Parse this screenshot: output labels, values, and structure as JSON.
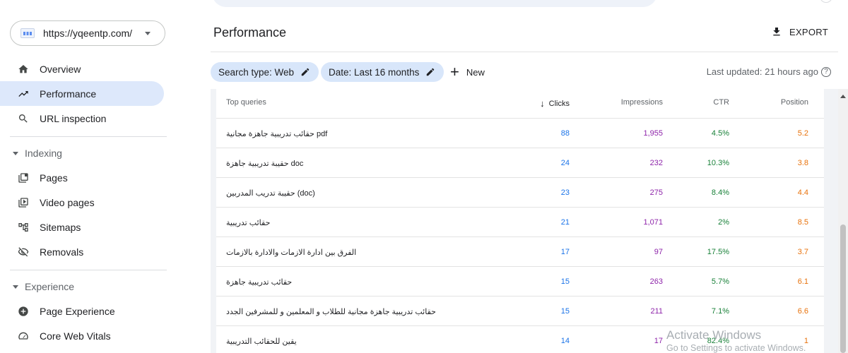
{
  "sidebar": {
    "property_url": "https://yqeentp.com/",
    "nav": [
      {
        "label": "Overview",
        "icon": "home-icon"
      },
      {
        "label": "Performance",
        "icon": "trending-up-icon",
        "active": true
      },
      {
        "label": "URL inspection",
        "icon": "search-icon"
      }
    ],
    "indexing": {
      "heading": "Indexing",
      "items": [
        {
          "label": "Pages",
          "icon": "pages-icon"
        },
        {
          "label": "Video pages",
          "icon": "video-icon"
        },
        {
          "label": "Sitemaps",
          "icon": "sitemap-icon"
        },
        {
          "label": "Removals",
          "icon": "removals-icon"
        }
      ]
    },
    "experience": {
      "heading": "Experience",
      "items": [
        {
          "label": "Page Experience",
          "icon": "page-experience-icon"
        },
        {
          "label": "Core Web Vitals",
          "icon": "speedometer-icon"
        }
      ]
    }
  },
  "header": {
    "title": "Performance",
    "export_label": "EXPORT"
  },
  "filters": {
    "search_type": "Search type: Web",
    "date": "Date: Last 16 months",
    "new_label": "New",
    "last_updated": "Last updated: 21 hours ago"
  },
  "table": {
    "columns": {
      "query": "Top queries",
      "clicks": "Clicks",
      "impressions": "Impressions",
      "ctr": "CTR",
      "position": "Position"
    },
    "rows": [
      {
        "query": "حقائب تدريبية جاهزة مجانية pdf",
        "clicks": "88",
        "impressions": "1,955",
        "ctr": "4.5%",
        "position": "5.2"
      },
      {
        "query": "حقيبة تدريبية جاهزة doc",
        "clicks": "24",
        "impressions": "232",
        "ctr": "10.3%",
        "position": "3.8"
      },
      {
        "query": "حقيبة تدريب المدربين (doc)",
        "clicks": "23",
        "impressions": "275",
        "ctr": "8.4%",
        "position": "4.4"
      },
      {
        "query": "حقائب تدريبية",
        "clicks": "21",
        "impressions": "1,071",
        "ctr": "2%",
        "position": "8.5"
      },
      {
        "query": "الفرق بين ادارة الازمات والادارة بالازمات",
        "clicks": "17",
        "impressions": "97",
        "ctr": "17.5%",
        "position": "3.7"
      },
      {
        "query": "حقائب تدريبية جاهزة",
        "clicks": "15",
        "impressions": "263",
        "ctr": "5.7%",
        "position": "6.1"
      },
      {
        "query": "حقائب تدريبية جاهزة مجانية للطلاب و المعلمين و للمشرفين الجدد",
        "clicks": "15",
        "impressions": "211",
        "ctr": "7.1%",
        "position": "6.6"
      },
      {
        "query": "يقين للحقائب التدريبية",
        "clicks": "14",
        "impressions": "17",
        "ctr": "82.4%",
        "position": "1"
      }
    ]
  },
  "watermark": {
    "line1": "Activate Windows",
    "line2": "Go to Settings to activate Windows."
  },
  "colors": {
    "clicks": "#1a73e8",
    "impressions": "#8e24aa",
    "ctr": "#188038",
    "position": "#e8710a",
    "active_nav": "#dde8fb",
    "chip": "#d8e6fa"
  }
}
